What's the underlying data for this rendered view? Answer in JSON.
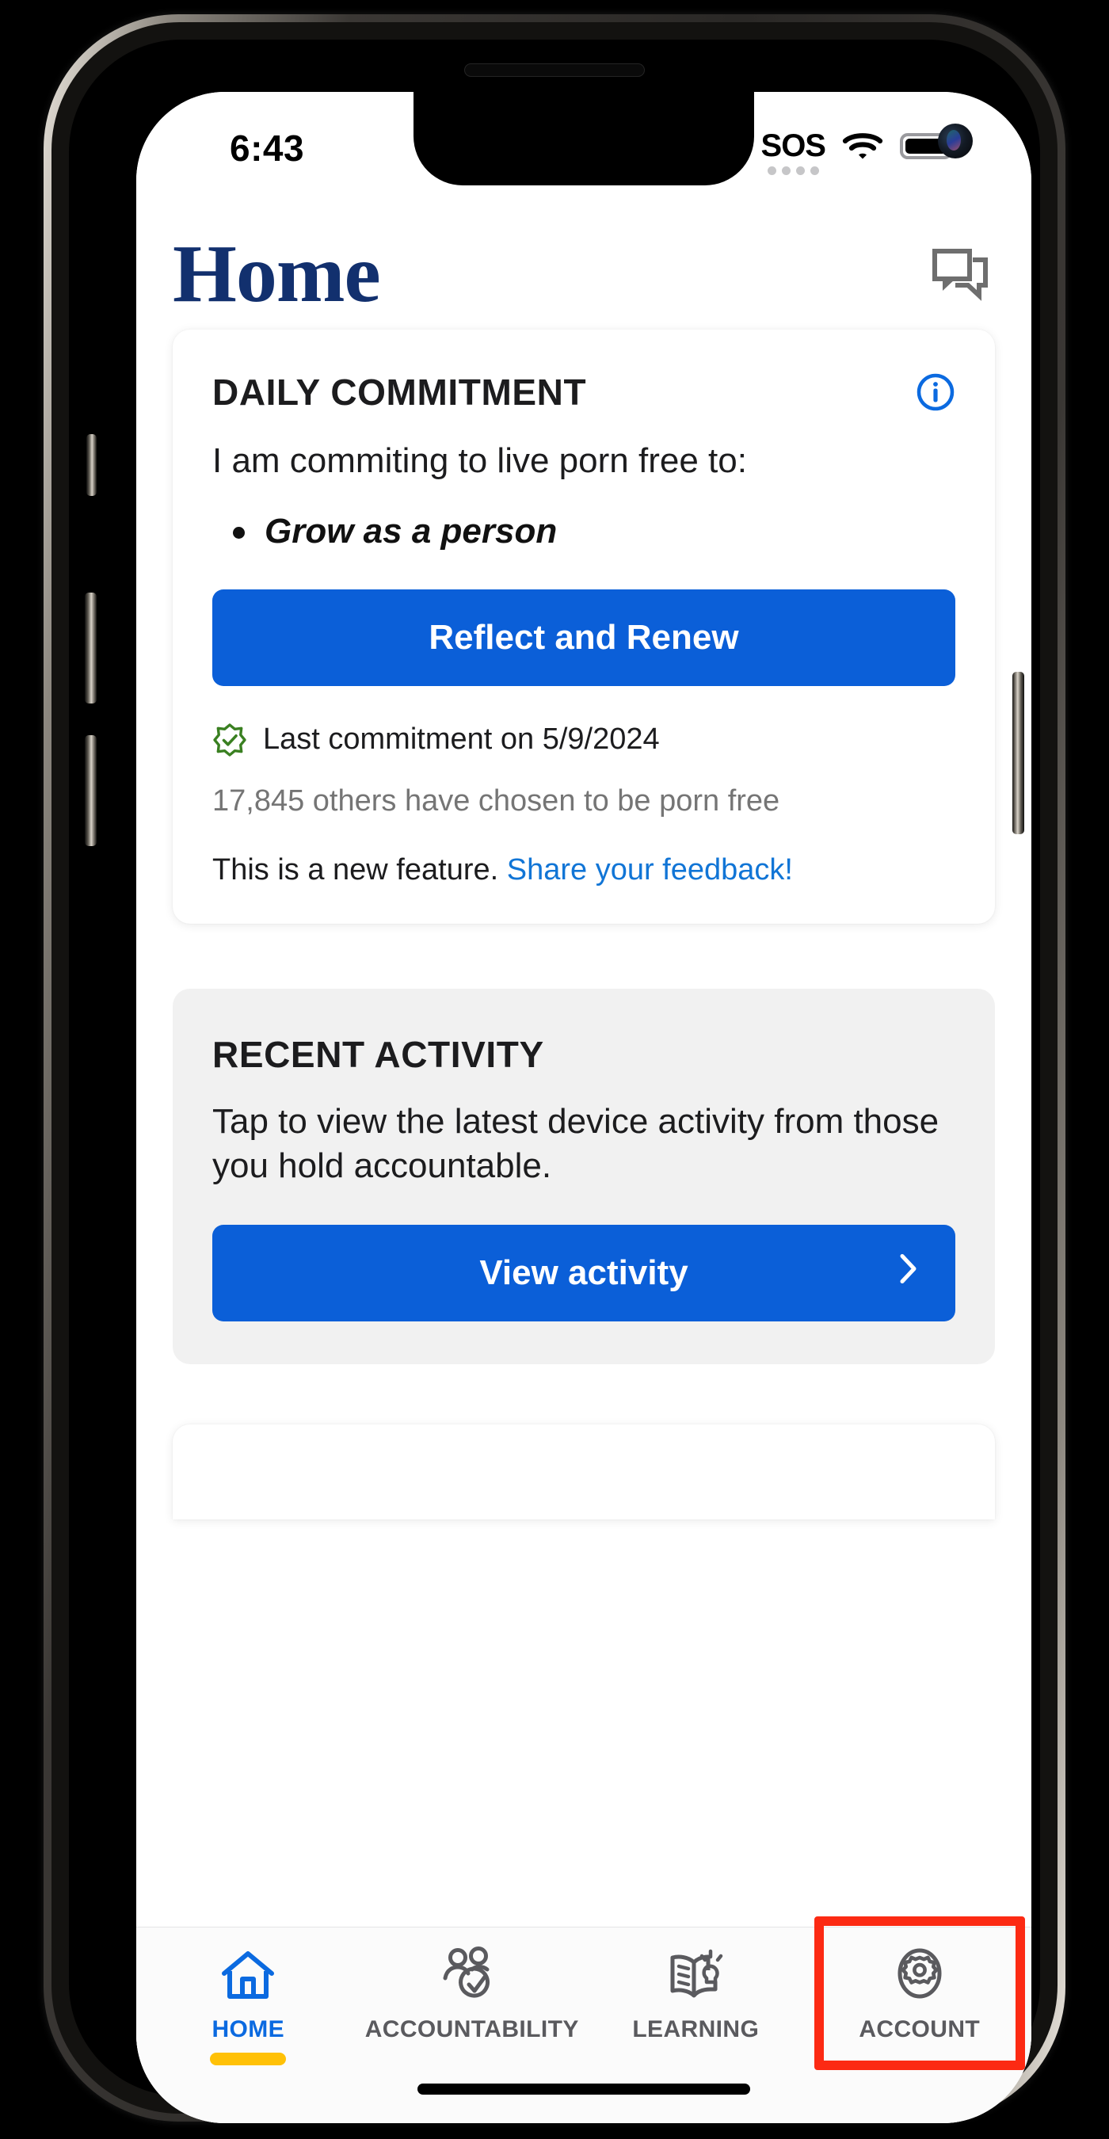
{
  "status_bar": {
    "time": "6:43",
    "sos_label": "SOS",
    "wifi_icon": "wifi-icon",
    "battery_icon": "battery-full-icon",
    "signal_dots": 4
  },
  "header": {
    "title": "Home",
    "chat_icon": "chat-bubbles-icon"
  },
  "daily_commitment": {
    "title": "DAILY COMMITMENT",
    "info_icon": "info-circle-icon",
    "lead": "I am commiting to live porn free to:",
    "goals": [
      "Grow as a person"
    ],
    "primary_button": "Reflect and Renew",
    "badge_icon": "verified-check-icon",
    "last_commitment": "Last commitment on 5/9/2024",
    "others_count": "17,845 others have chosen to be porn free",
    "feature_note": "This is a new feature.",
    "feedback_link": "Share your feedback!"
  },
  "recent_activity": {
    "title": "RECENT ACTIVITY",
    "description": "Tap to view the latest device activity from those you hold accountable.",
    "button_label": "View activity",
    "chevron_icon": "chevron-right-icon"
  },
  "tabs": [
    {
      "label": "HOME",
      "icon": "home-icon",
      "active": true,
      "highlighted": false
    },
    {
      "label": "ACCOUNTABILITY",
      "icon": "people-check-icon",
      "active": false,
      "highlighted": false
    },
    {
      "label": "LEARNING",
      "icon": "book-lightbulb-icon",
      "active": false,
      "highlighted": false
    },
    {
      "label": "ACCOUNT",
      "icon": "gear-shield-icon",
      "active": false,
      "highlighted": true
    }
  ],
  "colors": {
    "brand_navy": "#12306e",
    "accent_blue": "#0b5fd8",
    "link_blue": "#1175d6",
    "success_green": "#3a8021",
    "active_underline": "#ffc107",
    "highlight_red": "#fc2a13",
    "muted_text": "#757575"
  }
}
